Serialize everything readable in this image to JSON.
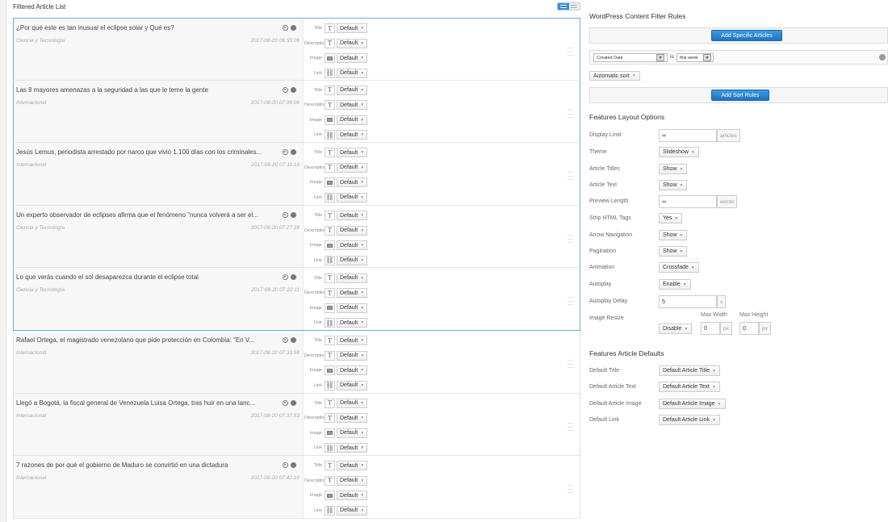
{
  "left": {
    "title": "Filtered Article List"
  },
  "field_labels": {
    "title": "Title",
    "description": "Description",
    "image": "Image",
    "link": "Link"
  },
  "field_default": "Default",
  "articles": [
    {
      "title": "¿Por qué este es tan inusual el eclipse solar y Qué es?",
      "category": "Ciencia y Tecnología",
      "date": "2017-08-20 06:55:06"
    },
    {
      "title": "Las 8 mayores amenazas a la seguridad a las que le teme la gente",
      "category": "Internacional",
      "date": "2017-08-20 07:06:06"
    },
    {
      "title": "Jesús Lemus, periodista arrestado por narco que vivió 1.100 días con los criminales...",
      "category": "Internacional",
      "date": "2017-08-20 07:11:19"
    },
    {
      "title": "Un experto observador de eclipses afirma que el fenómeno \"nunca volverá a ser el...",
      "category": "Ciencia y Tecnología",
      "date": "2017-08-20 07:27:39"
    },
    {
      "title": "Lo que verás cuando el sol desaparezca durante el eclipse total",
      "category": "Ciencia y Tecnología",
      "date": "2017-08-20 07:22:11"
    },
    {
      "title": "Rafael Ortega, el magistrado venezolano que pide protección en Colombia: \"En V...",
      "category": "Internacional",
      "date": "2017-08-20 07:33:58"
    },
    {
      "title": "Llegó a Bogotá, la fiscal general de Venezuela Luisa Ortega, tras huir en una lanc...",
      "category": "Internacional",
      "date": "2017-08-20 07:37:53"
    },
    {
      "title": "7 razones de por qué el gobierno de Maduro se convirtió en una dictadura",
      "category": "Internacional",
      "date": "2017-08-20 07:42:10"
    }
  ],
  "filter": {
    "title": "WordPress Content Filter Rules",
    "add_specific": "Add Specific Articles",
    "field": "Created Date",
    "operator": "is",
    "value": "this week",
    "sort": "Automatic sort",
    "add_sort": "Add Sort Rules"
  },
  "layout": {
    "title": "Features Layout Options",
    "display_limit": {
      "label": "Display Limit",
      "value": "∞",
      "unit": "articles"
    },
    "theme": {
      "label": "Theme",
      "value": "Slideshow"
    },
    "article_titles": {
      "label": "Article Titles",
      "value": "Show"
    },
    "article_text": {
      "label": "Article Text",
      "value": "Show"
    },
    "preview_length": {
      "label": "Preview Length",
      "value": "∞",
      "unit": "words"
    },
    "strip_html": {
      "label": "Strip HTML Tags",
      "value": "Yes"
    },
    "arrow_nav": {
      "label": "Arrow Navigation",
      "value": "Show"
    },
    "pagination": {
      "label": "Pagination",
      "value": "Show"
    },
    "animation": {
      "label": "Animation",
      "value": "Crossfade"
    },
    "autoplay": {
      "label": "Autoplay",
      "value": "Enable"
    },
    "autoplay_delay": {
      "label": "Autoplay Delay",
      "value": "5",
      "unit": "s"
    },
    "image_resize": {
      "label": "Image Resize",
      "value": "Disable",
      "max_width_label": "Max Width",
      "max_height_label": "Max Height",
      "width": "0",
      "height": "0",
      "unit": "px"
    }
  },
  "defaults": {
    "title": "Features Article Defaults",
    "default_title": {
      "label": "Default Title",
      "value": "Default Article Title"
    },
    "default_text": {
      "label": "Default Article Text",
      "value": "Default Article Text"
    },
    "default_image": {
      "label": "Default Article Image",
      "value": "Default Article Image"
    },
    "default_link": {
      "label": "Default Link",
      "value": "Default Article Link"
    }
  }
}
